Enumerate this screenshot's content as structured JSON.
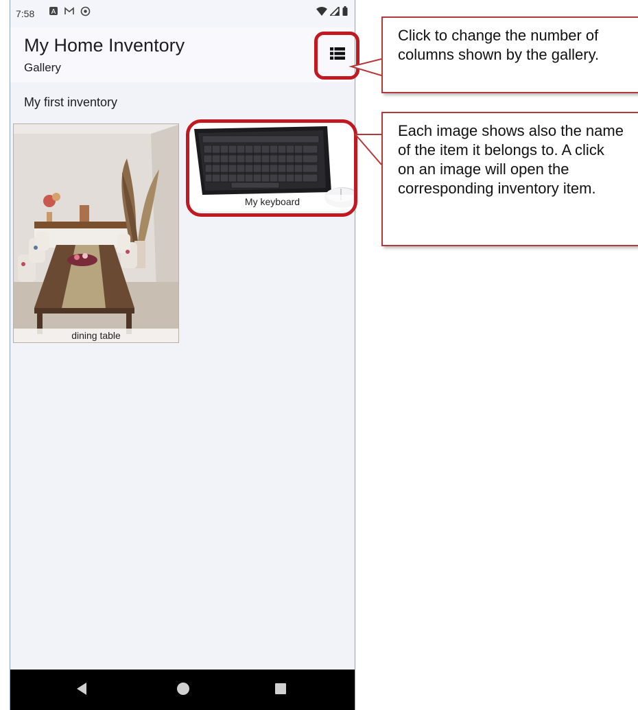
{
  "status_bar": {
    "time": "7:58",
    "left_icons": [
      "notification-a-icon",
      "gmail-icon",
      "sync-icon"
    ],
    "right_icons": [
      "wifi-icon",
      "signal-icon",
      "battery-icon"
    ]
  },
  "app_bar": {
    "title": "My Home Inventory",
    "subtitle": "Gallery",
    "columns_button_icon": "view-list-icon"
  },
  "section": {
    "title": "My first inventory"
  },
  "gallery": {
    "items": [
      {
        "caption": "dining table",
        "image": "dining-room-photo"
      },
      {
        "caption": "My keyboard",
        "image": "keyboard-mouse-photo"
      }
    ]
  },
  "nav_bar": {
    "buttons": [
      "back-icon",
      "home-icon",
      "recents-icon"
    ]
  },
  "annotations": {
    "callout_1": "Click to change the number of columns shown by the gallery.",
    "callout_2": "Each image shows also the name of the item it belongs to. A click on an image will open the corresponding inventory item."
  },
  "colors": {
    "highlight": "#c01a20",
    "phone_background": "#f2f3f9",
    "nav_bar": "#000000"
  }
}
